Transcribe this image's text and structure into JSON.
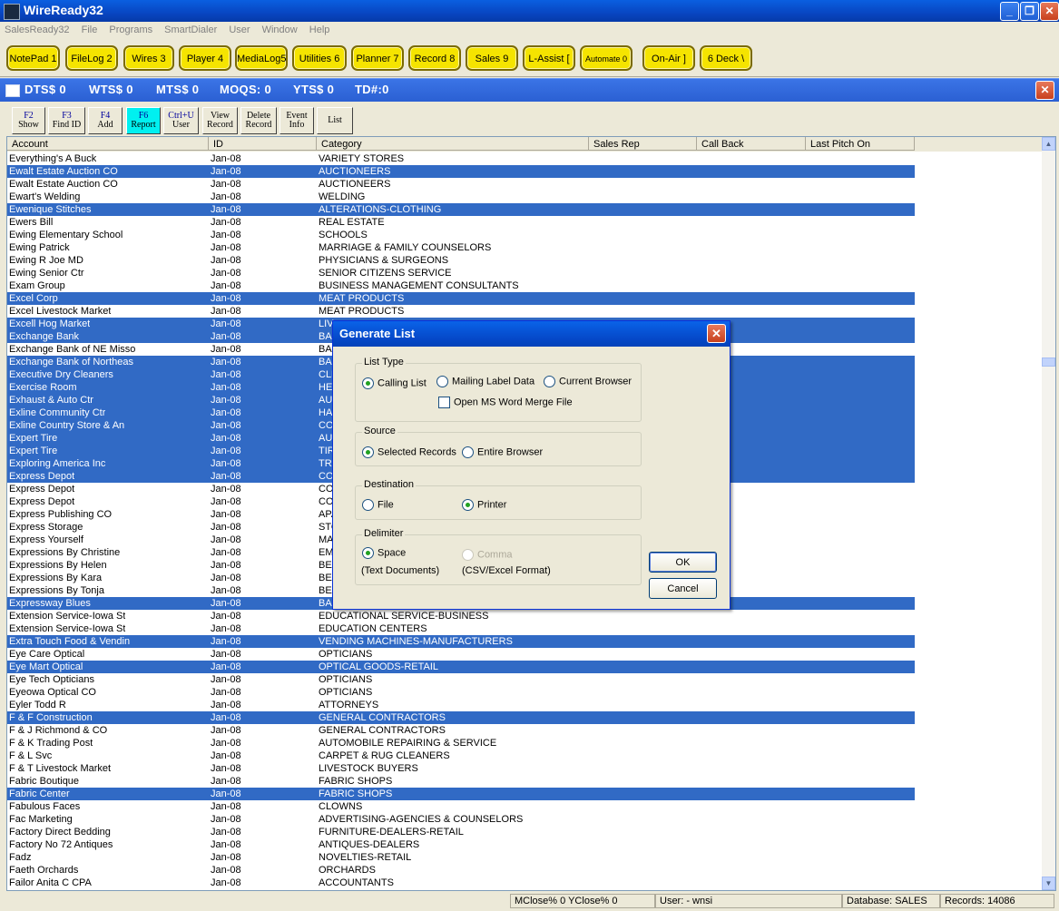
{
  "window": {
    "title": "WireReady32"
  },
  "menu": [
    "SalesReady32",
    "File",
    "Programs",
    "SmartDialer",
    "User",
    "Window",
    "Help"
  ],
  "app_buttons": [
    "NotePad 1",
    "FileLog 2",
    "Wires 3",
    "Player 4",
    "MediaLog5",
    "Utilities 6",
    "Planner 7",
    "Record 8",
    "Sales 9",
    "L-Assist [",
    "Automate 0",
    "On-Air ]",
    "6 Deck \\"
  ],
  "mdi": {
    "stats": [
      "DTS$ 0",
      "WTS$ 0",
      "MTS$ 0",
      "MOQS: 0",
      "YTS$ 0",
      "TD#:0"
    ]
  },
  "toolbar": [
    {
      "key": "F2",
      "label": "Show"
    },
    {
      "key": "F3",
      "label": "Find ID"
    },
    {
      "key": "F4",
      "label": "Add"
    },
    {
      "key": "F6",
      "label": "Report"
    },
    {
      "key": "Ctrl+U",
      "label": "User"
    },
    {
      "key": "View",
      "label": "Record"
    },
    {
      "key": "Delete",
      "label": "Record"
    },
    {
      "key": "Event",
      "label": "Info"
    },
    {
      "key": "",
      "label": "List"
    }
  ],
  "grid": {
    "columns": [
      "Account",
      "ID",
      "Category",
      "Sales Rep",
      "Call Back",
      "Last Pitch On"
    ],
    "rows": [
      {
        "account": "Everything's A Buck",
        "id": "Jan-08",
        "category": "VARIETY STORES",
        "sel": false
      },
      {
        "account": "Ewalt Estate Auction CO",
        "id": "Jan-08",
        "category": "AUCTIONEERS",
        "sel": true
      },
      {
        "account": "Ewalt Estate Auction CO",
        "id": "Jan-08",
        "category": "AUCTIONEERS",
        "sel": false
      },
      {
        "account": "Ewart's Welding",
        "id": "Jan-08",
        "category": "WELDING",
        "sel": false
      },
      {
        "account": "Ewenique Stitches",
        "id": "Jan-08",
        "category": "ALTERATIONS-CLOTHING",
        "sel": true
      },
      {
        "account": "Ewers Bill",
        "id": "Jan-08",
        "category": "REAL ESTATE",
        "sel": false
      },
      {
        "account": "Ewing Elementary School",
        "id": "Jan-08",
        "category": "SCHOOLS",
        "sel": false
      },
      {
        "account": "Ewing Patrick",
        "id": "Jan-08",
        "category": "MARRIAGE & FAMILY COUNSELORS",
        "sel": false
      },
      {
        "account": "Ewing R Joe MD",
        "id": "Jan-08",
        "category": "PHYSICIANS & SURGEONS",
        "sel": false
      },
      {
        "account": "Ewing Senior Ctr",
        "id": "Jan-08",
        "category": "SENIOR CITIZENS SERVICE",
        "sel": false
      },
      {
        "account": "Exam Group",
        "id": "Jan-08",
        "category": "BUSINESS MANAGEMENT CONSULTANTS",
        "sel": false
      },
      {
        "account": "Excel Corp",
        "id": "Jan-08",
        "category": "MEAT PRODUCTS",
        "sel": true
      },
      {
        "account": "Excel Livestock Market",
        "id": "Jan-08",
        "category": "MEAT PRODUCTS",
        "sel": false
      },
      {
        "account": "Excell Hog Market",
        "id": "Jan-08",
        "category": "LIV",
        "sel": true
      },
      {
        "account": "Exchange Bank",
        "id": "Jan-08",
        "category": "BAN",
        "sel": true
      },
      {
        "account": "Exchange Bank of NE Misso",
        "id": "Jan-08",
        "category": "BAN",
        "sel": false
      },
      {
        "account": "Exchange Bank of Northeas",
        "id": "Jan-08",
        "category": "BAN",
        "sel": true
      },
      {
        "account": "Executive Dry Cleaners",
        "id": "Jan-08",
        "category": "CLE",
        "sel": true
      },
      {
        "account": "Exercise Room",
        "id": "Jan-08",
        "category": "HEA",
        "sel": true
      },
      {
        "account": "Exhaust & Auto Ctr",
        "id": "Jan-08",
        "category": "AUT",
        "sel": true
      },
      {
        "account": "Exline Community Ctr",
        "id": "Jan-08",
        "category": "HAL",
        "sel": true
      },
      {
        "account": "Exline Country Store & An",
        "id": "Jan-08",
        "category": "CO",
        "sel": true
      },
      {
        "account": "Expert Tire",
        "id": "Jan-08",
        "category": "AUT",
        "sel": true
      },
      {
        "account": "Expert Tire",
        "id": "Jan-08",
        "category": "TIR",
        "sel": true
      },
      {
        "account": "Exploring America Inc",
        "id": "Jan-08",
        "category": "TRA",
        "sel": true
      },
      {
        "account": "Express Depot",
        "id": "Jan-08",
        "category": "CO",
        "sel": true
      },
      {
        "account": "Express Depot",
        "id": "Jan-08",
        "category": "CO",
        "sel": false
      },
      {
        "account": "Express Depot",
        "id": "Jan-08",
        "category": "CO",
        "sel": false
      },
      {
        "account": "Express Publishing CO",
        "id": "Jan-08",
        "category": "APA",
        "sel": false
      },
      {
        "account": "Express Storage",
        "id": "Jan-08",
        "category": "STO",
        "sel": false
      },
      {
        "account": "Express Yourself",
        "id": "Jan-08",
        "category": "MA",
        "sel": false
      },
      {
        "account": "Expressions By Christine",
        "id": "Jan-08",
        "category": "EME",
        "sel": false
      },
      {
        "account": "Expressions By Helen",
        "id": "Jan-08",
        "category": "BEA",
        "sel": false
      },
      {
        "account": "Expressions By Kara",
        "id": "Jan-08",
        "category": "BEA",
        "sel": false
      },
      {
        "account": "Expressions By Tonja",
        "id": "Jan-08",
        "category": "BEA",
        "sel": false
      },
      {
        "account": "Expressway Blues",
        "id": "Jan-08",
        "category": "BAR",
        "sel": true
      },
      {
        "account": "Extension Service-Iowa St",
        "id": "Jan-08",
        "category": "EDUCATIONAL SERVICE-BUSINESS",
        "sel": false
      },
      {
        "account": "Extension Service-Iowa St",
        "id": "Jan-08",
        "category": "EDUCATION CENTERS",
        "sel": false
      },
      {
        "account": "Extra Touch Food & Vendin",
        "id": "Jan-08",
        "category": "VENDING MACHINES-MANUFACTURERS",
        "sel": true
      },
      {
        "account": "Eye Care Optical",
        "id": "Jan-08",
        "category": "OPTICIANS",
        "sel": false
      },
      {
        "account": "Eye Mart Optical",
        "id": "Jan-08",
        "category": "OPTICAL GOODS-RETAIL",
        "sel": true
      },
      {
        "account": "Eye Tech Opticians",
        "id": "Jan-08",
        "category": "OPTICIANS",
        "sel": false
      },
      {
        "account": "Eyeowa Optical CO",
        "id": "Jan-08",
        "category": "OPTICIANS",
        "sel": false
      },
      {
        "account": "Eyler Todd R",
        "id": "Jan-08",
        "category": "ATTORNEYS",
        "sel": false
      },
      {
        "account": "F & F Construction",
        "id": "Jan-08",
        "category": "GENERAL CONTRACTORS",
        "sel": true
      },
      {
        "account": "F & J Richmond & CO",
        "id": "Jan-08",
        "category": "GENERAL CONTRACTORS",
        "sel": false
      },
      {
        "account": "F & K Trading Post",
        "id": "Jan-08",
        "category": "AUTOMOBILE REPAIRING & SERVICE",
        "sel": false
      },
      {
        "account": "F & L Svc",
        "id": "Jan-08",
        "category": "CARPET & RUG CLEANERS",
        "sel": false
      },
      {
        "account": "F & T Livestock Market",
        "id": "Jan-08",
        "category": "LIVESTOCK BUYERS",
        "sel": false
      },
      {
        "account": "Fabric Boutique",
        "id": "Jan-08",
        "category": "FABRIC SHOPS",
        "sel": false
      },
      {
        "account": "Fabric Center",
        "id": "Jan-08",
        "category": "FABRIC SHOPS",
        "sel": true
      },
      {
        "account": "Fabulous Faces",
        "id": "Jan-08",
        "category": "CLOWNS",
        "sel": false
      },
      {
        "account": "Fac Marketing",
        "id": "Jan-08",
        "category": "ADVERTISING-AGENCIES & COUNSELORS",
        "sel": false
      },
      {
        "account": "Factory Direct Bedding",
        "id": "Jan-08",
        "category": "FURNITURE-DEALERS-RETAIL",
        "sel": false
      },
      {
        "account": "Factory No 72 Antiques",
        "id": "Jan-08",
        "category": "ANTIQUES-DEALERS",
        "sel": false
      },
      {
        "account": "Fadz",
        "id": "Jan-08",
        "category": "NOVELTIES-RETAIL",
        "sel": false
      },
      {
        "account": "Faeth Orchards",
        "id": "Jan-08",
        "category": "ORCHARDS",
        "sel": false
      },
      {
        "account": "Failor Anita C CPA",
        "id": "Jan-08",
        "category": "ACCOUNTANTS",
        "sel": false
      }
    ]
  },
  "status": {
    "mclose": "MClose% 0 YClose% 0",
    "user": "User:  - wnsi",
    "database": "Database: SALES",
    "records": "Records: 14086"
  },
  "dialog": {
    "title": "Generate List",
    "list_type": {
      "legend": "List Type",
      "calling": "Calling List",
      "mailing": "Mailing Label Data",
      "browser": "Current Browser",
      "merge": "Open MS Word Merge File"
    },
    "source": {
      "legend": "Source",
      "selected": "Selected Records",
      "entire": "Entire Browser"
    },
    "destination": {
      "legend": "Destination",
      "file": "File",
      "printer": "Printer"
    },
    "delimiter": {
      "legend": "Delimiter",
      "space": "Space",
      "space_note": "(Text Documents)",
      "comma": "Comma",
      "comma_note": "(CSV/Excel Format)"
    },
    "ok": "OK",
    "cancel": "Cancel"
  }
}
